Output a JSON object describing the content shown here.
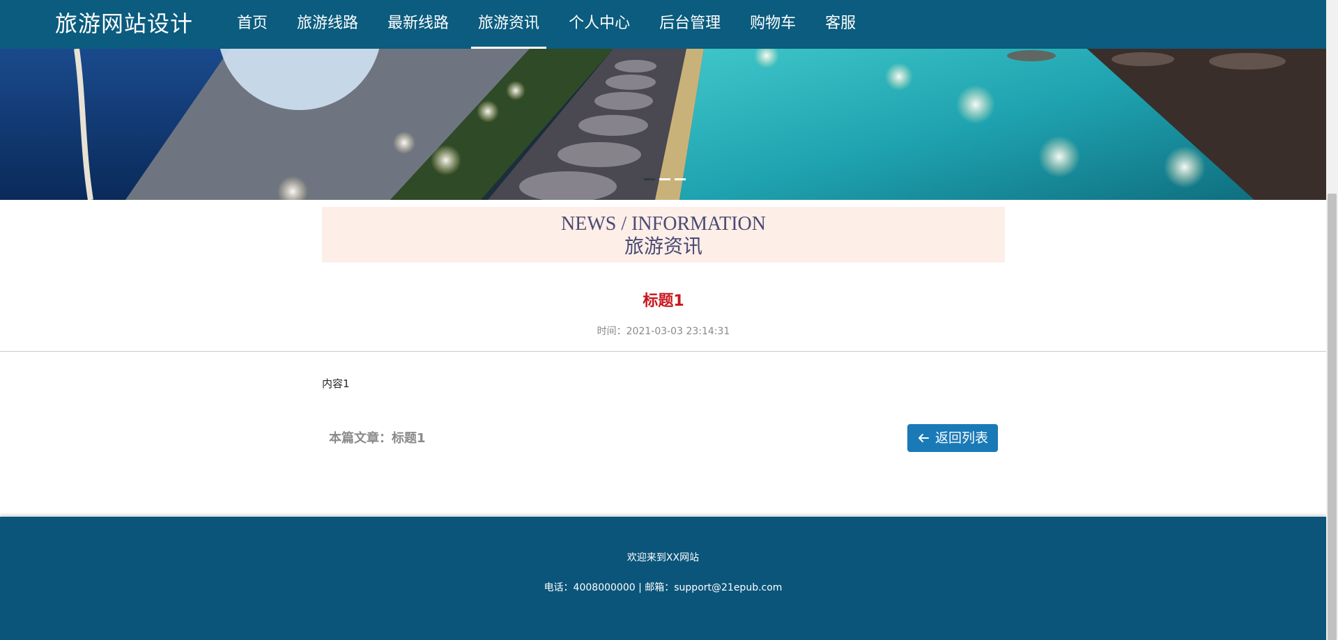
{
  "header": {
    "brand": "旅游网站设计",
    "nav": [
      {
        "label": "首页",
        "active": false
      },
      {
        "label": "旅游线路",
        "active": false
      },
      {
        "label": "最新线路",
        "active": false
      },
      {
        "label": "旅游资讯",
        "active": true
      },
      {
        "label": "个人中心",
        "active": false
      },
      {
        "label": "后台管理",
        "active": false
      },
      {
        "label": "购物车",
        "active": false
      },
      {
        "label": "客服",
        "active": false
      }
    ]
  },
  "banner": {
    "carousel_dot_count": 3,
    "active_dot_index": 1
  },
  "section": {
    "title_en": "NEWS / INFORMATION",
    "title_cn": "旅游资讯"
  },
  "article": {
    "title": "标题1",
    "time": "时间：2021-03-03 23:14:31",
    "content": "内容1",
    "current_article": "本篇文章：标题1",
    "back_label": "返回列表"
  },
  "footer": {
    "welcome": "欢迎来到XX网站",
    "contact": "电话：4008000000 | 邮箱：support@21epub.com"
  },
  "colors": {
    "header_bg": "#0b5c7e",
    "footer_bg": "#0b557a",
    "section_bg": "#fdeee8",
    "title_red": "#c8161d",
    "button_blue": "#1a7ab8"
  }
}
